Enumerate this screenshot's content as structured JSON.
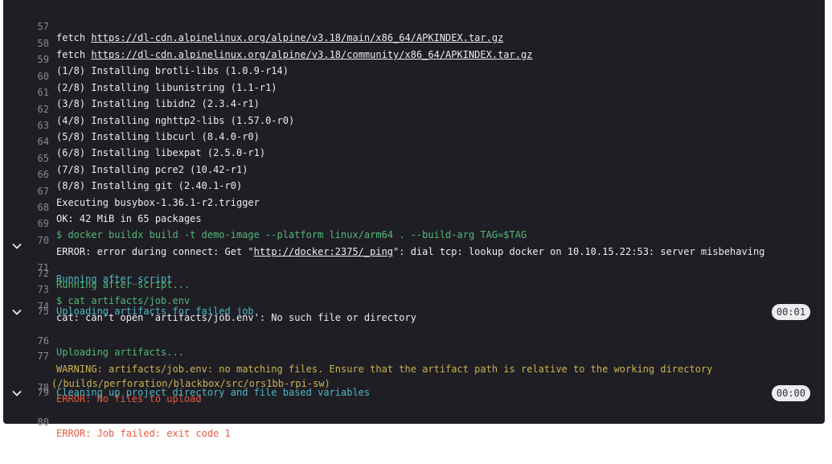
{
  "job_log": {
    "lines": [
      {
        "num": "57",
        "parts": [
          "fetch ",
          "https://dl-cdn.alpinelinux.org/alpine/v3.18/main/x86_64/APKINDEX.tar.gz"
        ]
      },
      {
        "num": "58",
        "parts": [
          "fetch ",
          "https://dl-cdn.alpinelinux.org/alpine/v3.18/community/x86_64/APKINDEX.tar.gz"
        ]
      },
      {
        "num": "59",
        "text": "(1/8) Installing brotli-libs (1.0.9-r14)"
      },
      {
        "num": "60",
        "text": "(2/8) Installing libunistring (1.1-r1)"
      },
      {
        "num": "61",
        "text": "(3/8) Installing libidn2 (2.3.4-r1)"
      },
      {
        "num": "62",
        "text": "(4/8) Installing nghttp2-libs (1.57.0-r0)"
      },
      {
        "num": "63",
        "text": "(5/8) Installing libcurl (8.4.0-r0)"
      },
      {
        "num": "64",
        "text": "(6/8) Installing libexpat (2.5.0-r1)"
      },
      {
        "num": "65",
        "text": "(7/8) Installing pcre2 (10.42-r1)"
      },
      {
        "num": "66",
        "text": "(8/8) Installing git (2.40.1-r0)"
      },
      {
        "num": "67",
        "text": "Executing busybox-1.36.1-r2.trigger"
      },
      {
        "num": "68",
        "text": "OK: 42 MiB in 65 packages"
      },
      {
        "num": "69",
        "text": "$ docker buildx build -t demo-image --platform linux/arm64 . --build-arg TAG=$TAG",
        "color": "#52b87a"
      },
      {
        "num": "70",
        "parts": [
          "ERROR: error during connect: Get \"",
          "http://docker:2375/_ping",
          "\": dial tcp: lookup docker on 10.10.15.22:53: server misbehaving"
        ]
      },
      {
        "num": "71",
        "text": "Running after_script",
        "section": true
      },
      {
        "num": "72",
        "text": "Running after script...",
        "color": "#52b87a"
      },
      {
        "num": "73",
        "text": "$ cat artifacts/job.env",
        "color": "#52b87a"
      },
      {
        "num": "74",
        "text": "cat: can't open 'artifacts/job.env': No such file or directory"
      },
      {
        "num": "75",
        "text": "Uploading artifacts for failed job",
        "section": true,
        "duration": "00:01"
      },
      {
        "num": "76",
        "text": "Uploading artifacts...",
        "color": "#52b87a"
      },
      {
        "num": "77",
        "text": "WARNING: artifacts/job.env: no matching files. Ensure that the artifact path is relative to the working directory (/builds/perforation/blackbox/src/ors1bb-rpi-sw)",
        "color": "#c9b451"
      },
      {
        "num": "78",
        "text": "ERROR: No files to upload",
        "color": "#ec5941"
      },
      {
        "num": "79",
        "text": "Cleaning up project directory and file based variables",
        "section": true,
        "duration": "00:00"
      },
      {
        "num": "80",
        "text": "ERROR: Job failed: exit code 1",
        "color": "#ec5941"
      }
    ]
  },
  "colors": {
    "terminal_bg": "#1f1e24",
    "text": "#ececef",
    "line_number": "#89888d",
    "green": "#52b87a",
    "cyan": "#4db8c4",
    "yellow": "#c9b451",
    "red": "#ec5941",
    "badge_bg": "#ececef"
  },
  "icons": {
    "section_toggle": "chevron-down-icon"
  }
}
